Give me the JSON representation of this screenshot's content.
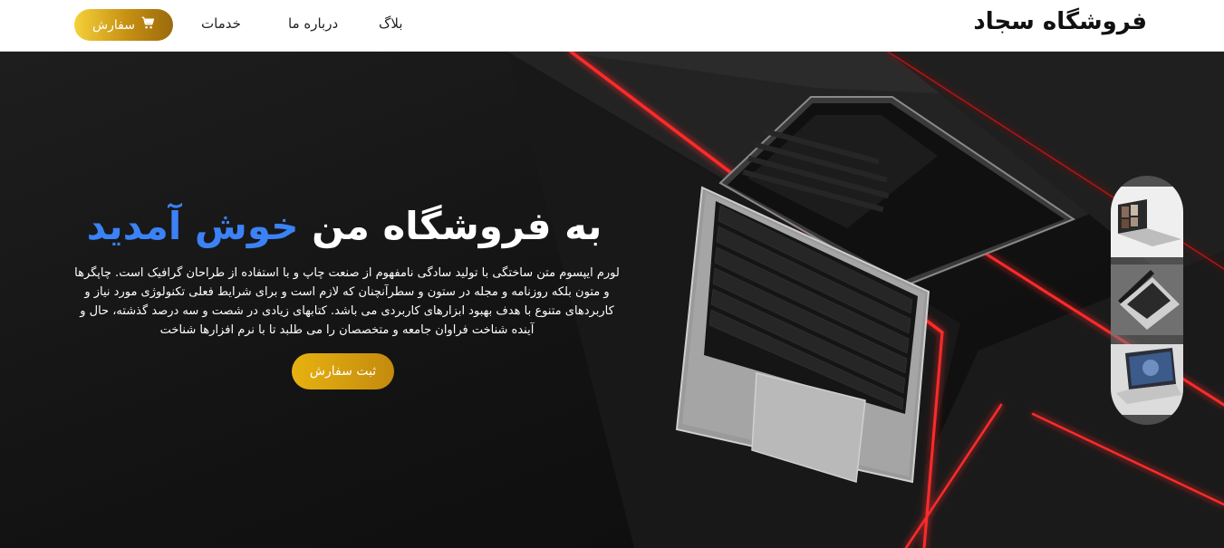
{
  "header": {
    "brand": "فروشگاه سجاد",
    "nav": {
      "blog": "بلاگ",
      "about": "درباره ما",
      "services": "خدمات"
    },
    "order_button": "سفارش"
  },
  "hero": {
    "title_main": "به فروشگاه من",
    "title_accent": "خوش آمدید",
    "description": "لورم ایپسوم متن ساختگی با تولید سادگی نامفهوم از صنعت چاپ و با استفاده از طراحان گرافیک است. چاپگرها و متون بلکه روزنامه و مجله در ستون و سطرآنچنان که لازم است و برای شرایط فعلی تکنولوژی مورد نیاز و کاربردهای متنوع با هدف بهبود ابزارهای کاربردی می باشد. کتابهای زیادی در شصت و سه درصد گذشته، حال و آینده شناخت فراوان جامعه و متخصصان را می طلبد تا با نرم افزارها شناخت",
    "submit_button": "ثبت سفارش"
  },
  "colors": {
    "accent_blue": "#3b82f6",
    "gold": "#e7b211",
    "red_glow": "#ff2a2a",
    "background": "#141414"
  },
  "icons": {
    "cart": "cart-icon"
  }
}
